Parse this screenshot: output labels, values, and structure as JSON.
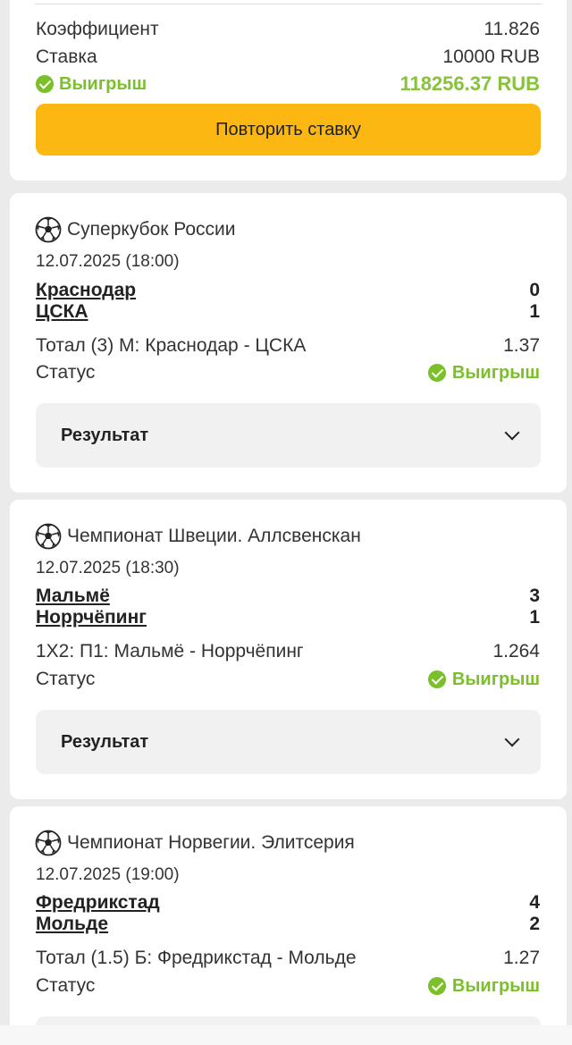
{
  "summary": {
    "coefficient_label": "Коэффициент",
    "coefficient_value": "11.826",
    "stake_label": "Ставка",
    "stake_value": "10000 RUB",
    "win_label": "Выигрыш",
    "win_value": "118256.37 RUB",
    "repeat_button": "Повторить ставку"
  },
  "matches": [
    {
      "league": "Суперкубок России",
      "datetime": "12.07.2025 (18:00)",
      "team1": "Краснодар",
      "score1": "0",
      "team2": "ЦСКА",
      "score2": "1",
      "bet": "Тотал (3) М: Краснодар - ЦСКА",
      "odds": "1.37",
      "status_label": "Статус",
      "status_value": "Выигрыш",
      "result_label": "Результат"
    },
    {
      "league": "Чемпионат Швеции. Аллсвенскан",
      "datetime": "12.07.2025 (18:30)",
      "team1": "Мальмё",
      "score1": "3",
      "team2": "Норрчёпинг",
      "score2": "1",
      "bet": "1X2: П1: Мальмё - Норрчёпинг",
      "odds": "1.264",
      "status_label": "Статус",
      "status_value": "Выигрыш",
      "result_label": "Результат"
    },
    {
      "league": "Чемпионат Норвегии. Элитсерия",
      "datetime": "12.07.2025 (19:00)",
      "team1": "Фредрикстад",
      "score1": "4",
      "team2": "Мольде",
      "score2": "2",
      "bet": "Тотал (1.5) Б: Фредрикстад - Мольде",
      "odds": "1.27",
      "status_label": "Статус",
      "status_value": "Выигрыш"
    }
  ],
  "colors": {
    "win_green": "#7bbf2a",
    "button_yellow": "#fcb712",
    "page_background": "#ebebeb"
  },
  "icons": {
    "sport": "soccer-ball-icon",
    "status": "check-circle-icon",
    "expand": "chevron-down-icon"
  }
}
